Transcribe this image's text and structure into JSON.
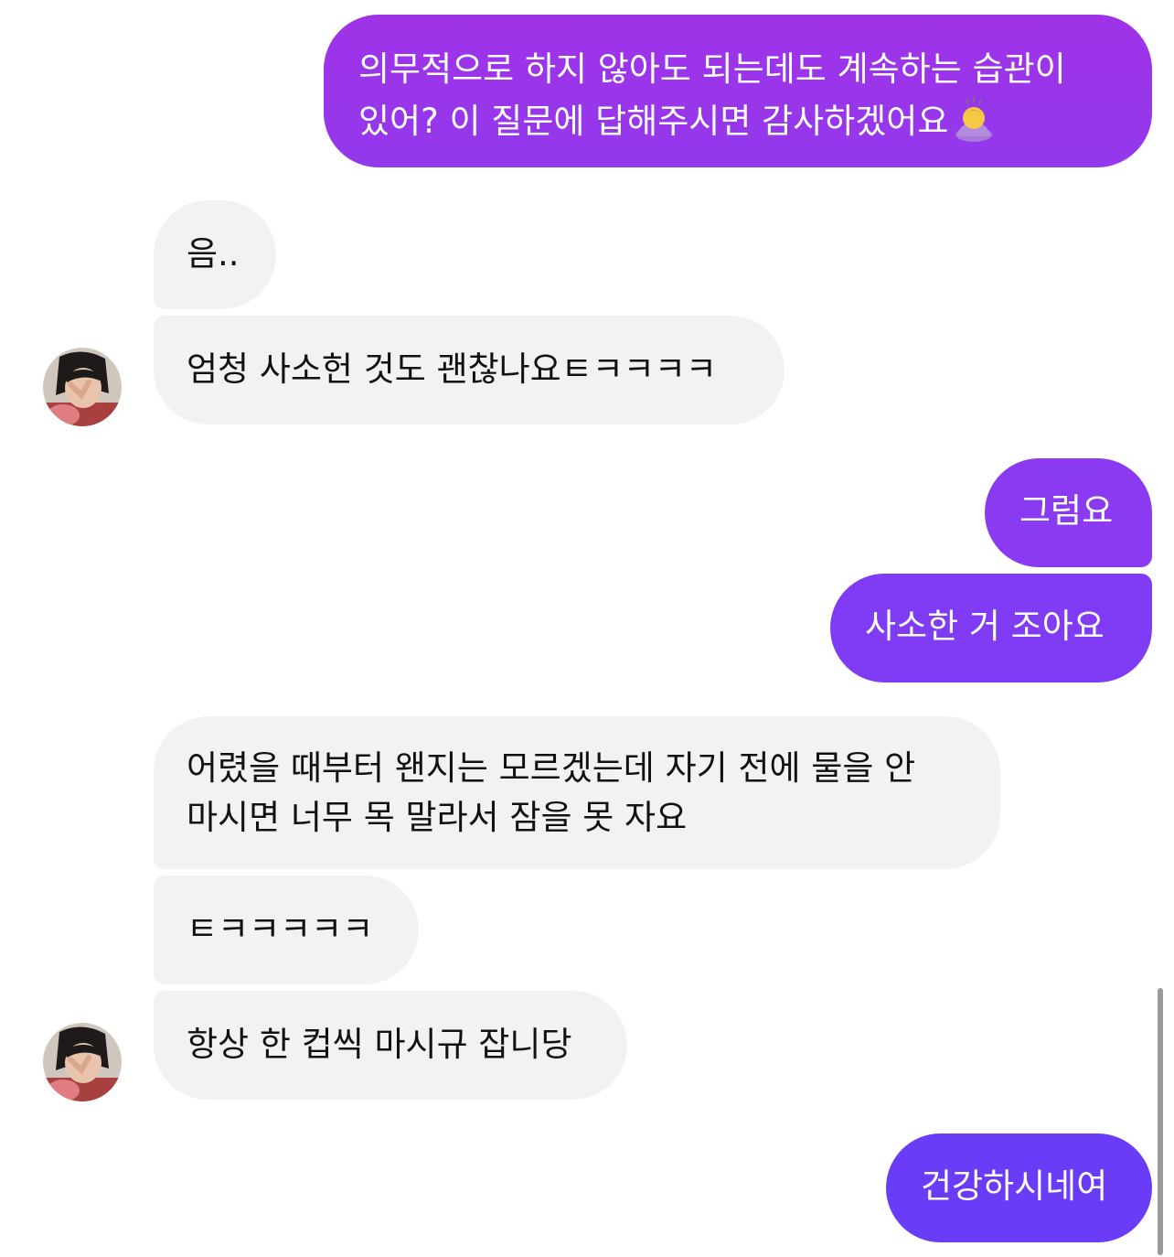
{
  "colors": {
    "sent_gradient_top": "#9b34e8",
    "sent_gradient_bottom": "#6b3cf7",
    "received_bg": "#f2f2f4"
  },
  "messages": [
    {
      "side": "sent",
      "lines": [
        "의무적으로 하지 않아도 되는데도 계속하는 습관이",
        "있어? 이 질문에 답해주시면 감사하겠어요"
      ],
      "emoji": "person-bowing-emoji"
    },
    {
      "side": "received",
      "lines": [
        "음.."
      ]
    },
    {
      "side": "received",
      "lines": [
        "엄청 사소헌 것도 괜찮나요ㅌㅋㅋㅋㅋ"
      ]
    },
    {
      "side": "sent",
      "lines": [
        "그럼요"
      ]
    },
    {
      "side": "sent",
      "lines": [
        "사소한 거 조아요"
      ]
    },
    {
      "side": "received",
      "lines": [
        "어렸을 때부터 왠지는 모르겠는데 자기 전에 물을 안",
        "마시면 너무 목 말라서 잠을 못 자요"
      ]
    },
    {
      "side": "received",
      "lines": [
        "ㅌㅋㅋㅋㅋㅋ"
      ]
    },
    {
      "side": "received",
      "lines": [
        "항상 한 컵씩 마시규 잡니당"
      ]
    },
    {
      "side": "sent",
      "lines": [
        "건강하시네여"
      ]
    }
  ]
}
